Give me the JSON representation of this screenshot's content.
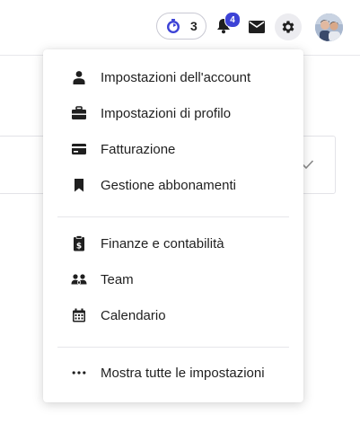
{
  "topbar": {
    "timer_count": "3",
    "notification_count": "4",
    "icons": {
      "timer": "stopwatch-icon",
      "notifications": "bell-icon",
      "messages": "mail-icon",
      "settings": "gear-icon",
      "profile": "avatar"
    },
    "accent_color": "#3d43d6"
  },
  "menu": {
    "groups": [
      {
        "items": [
          {
            "label": "Impostazioni dell'account",
            "icon": "person-icon"
          },
          {
            "label": "Impostazioni di profilo",
            "icon": "briefcase-icon"
          },
          {
            "label": "Fatturazione",
            "icon": "credit-card-icon"
          },
          {
            "label": "Gestione abbonamenti",
            "icon": "bookmark-icon"
          }
        ]
      },
      {
        "items": [
          {
            "label": "Finanze e contabilità",
            "icon": "clipboard-dollar-icon"
          },
          {
            "label": "Team",
            "icon": "team-icon"
          },
          {
            "label": "Calendario",
            "icon": "calendar-icon"
          }
        ]
      },
      {
        "items": [
          {
            "label": "Mostra tutte le impostazioni",
            "icon": "more-horizontal-icon"
          }
        ]
      }
    ]
  }
}
